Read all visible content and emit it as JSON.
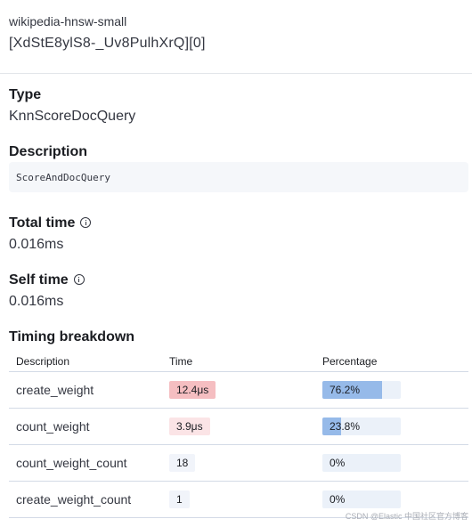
{
  "header": {
    "index_name": "wikipedia-hnsw-small",
    "shard_name": "[XdStE8ylS8-_Uv8PulhXrQ][0]"
  },
  "type": {
    "label": "Type",
    "value": "KnnScoreDocQuery"
  },
  "description": {
    "label": "Description",
    "value": "ScoreAndDocQuery"
  },
  "total_time": {
    "label": "Total time",
    "value": "0.016ms",
    "icon": "info-icon"
  },
  "self_time": {
    "label": "Self time",
    "value": "0.016ms",
    "icon": "info-icon"
  },
  "timing": {
    "label": "Timing breakdown",
    "columns": [
      "Description",
      "Time",
      "Percentage"
    ],
    "rows": [
      {
        "description": "create_weight",
        "time": "12.4μs",
        "percentage": "76.2%",
        "pct_value": 76.2,
        "time_color": "#f5bec1"
      },
      {
        "description": "count_weight",
        "time": "3.9μs",
        "percentage": "23.8%",
        "pct_value": 23.8,
        "time_color": "#fbe4e6"
      },
      {
        "description": "count_weight_count",
        "time": "18",
        "percentage": "0%",
        "pct_value": 0,
        "time_color": "#f1f4fa"
      },
      {
        "description": "create_weight_count",
        "time": "1",
        "percentage": "0%",
        "pct_value": 0,
        "time_color": "#f1f4fa"
      }
    ]
  },
  "watermark": "CSDN @Elastic 中国社区官方博客"
}
